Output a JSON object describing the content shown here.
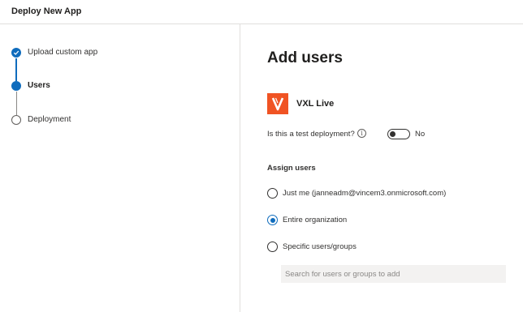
{
  "header": {
    "title": "Deploy New App"
  },
  "steps": [
    {
      "label": "Upload custom app",
      "state": "done"
    },
    {
      "label": "Users",
      "state": "current"
    },
    {
      "label": "Deployment",
      "state": "future"
    }
  ],
  "main": {
    "title": "Add users",
    "app": {
      "name": "VXL Live",
      "logo_color": "#f05323",
      "logo_icon": "vxl-logo-icon"
    },
    "test_deployment": {
      "label": "Is this a test deployment?",
      "info_icon": "info-icon",
      "toggle_on": false,
      "toggle_text": "No"
    },
    "assign": {
      "label": "Assign users",
      "options": [
        {
          "label": "Just me (janneadm@vincem3.onmicrosoft.com)",
          "checked": false
        },
        {
          "label": "Entire organization",
          "checked": true
        },
        {
          "label": "Specific users/groups",
          "checked": false
        }
      ],
      "search_placeholder": "Search for users or groups to add"
    }
  },
  "colors": {
    "accent": "#0f6cbd",
    "border": "#e1dfdd",
    "input_bg": "#f3f2f1"
  }
}
